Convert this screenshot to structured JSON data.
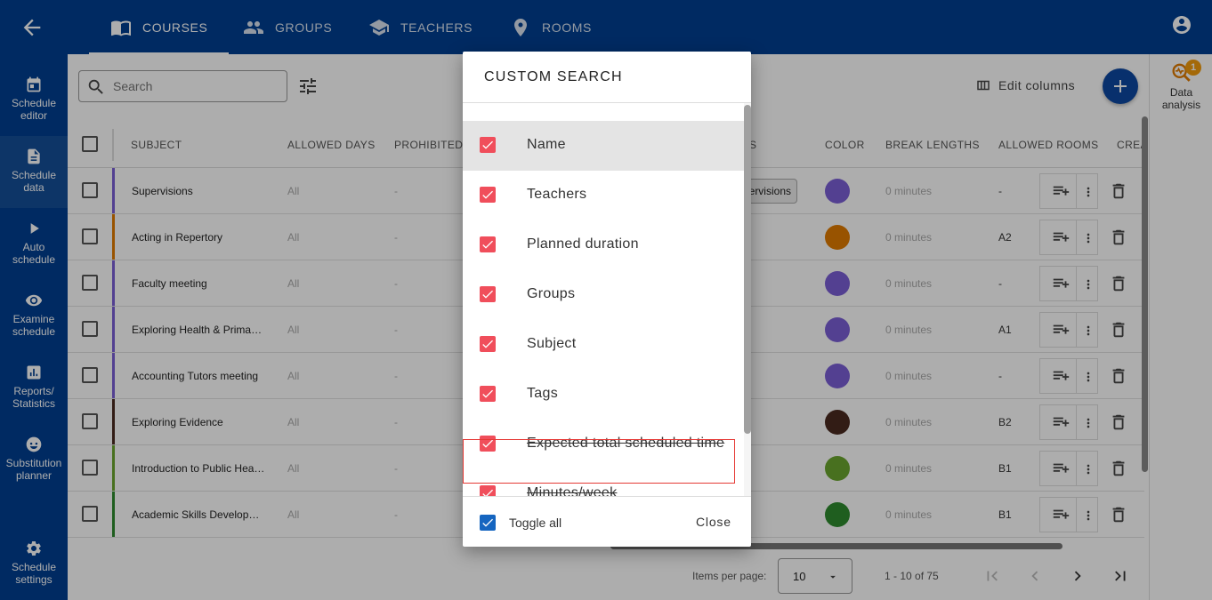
{
  "topnav": {
    "tabs": [
      {
        "label": "COURSES",
        "icon": "book-icon",
        "active": true
      },
      {
        "label": "GROUPS",
        "icon": "people-icon"
      },
      {
        "label": "TEACHERS",
        "icon": "school-icon"
      },
      {
        "label": "ROOMS",
        "icon": "location-pin-icon"
      }
    ]
  },
  "sidebar": {
    "items": [
      {
        "label1": "Schedule",
        "label2": "editor",
        "icon": "calendar-icon"
      },
      {
        "label1": "Schedule",
        "label2": "data",
        "icon": "document-icon"
      },
      {
        "label1": "Auto",
        "label2": "schedule",
        "icon": "play-icon"
      },
      {
        "label1": "Examine",
        "label2": "schedule",
        "icon": "eye-icon"
      },
      {
        "label1": "Reports/",
        "label2": "Statistics",
        "icon": "chart-icon"
      },
      {
        "label1": "Substitution",
        "label2": "planner",
        "icon": "face-icon"
      },
      {
        "label1": "Schedule",
        "label2": "settings",
        "icon": "gear-icon"
      }
    ]
  },
  "rightpanel": {
    "line1": "Data",
    "line2": "analysis",
    "badge": "1"
  },
  "toolbar": {
    "search_placeholder": "Search",
    "edit_columns": "Edit columns"
  },
  "table": {
    "headers": [
      "SUBJECT",
      "ALLOWED DAYS",
      "PROHIBITED T",
      "S",
      "COLOR",
      "BREAK LENGTHS",
      "ALLOWED ROOMS",
      "CREA"
    ],
    "rows": [
      {
        "subject": "Supervisions",
        "days": "All",
        "prohibited": "-",
        "tag": "ervisions",
        "color": "#7b5fd6",
        "bar": "#7b5fd6",
        "break": "0 minutes",
        "room": "-"
      },
      {
        "subject": "Acting in Repertory",
        "days": "All",
        "prohibited": "-",
        "color": "#e07b00",
        "bar": "#e07b00",
        "break": "0 minutes",
        "room": "A2"
      },
      {
        "subject": "Faculty meeting",
        "days": "All",
        "prohibited": "-",
        "color": "#7b5fd6",
        "bar": "#7b5fd6",
        "break": "0 minutes",
        "room": "-"
      },
      {
        "subject": "Exploring Health & Primary Care",
        "days": "All",
        "prohibited": "-",
        "color": "#7b5fd6",
        "bar": "#7b5fd6",
        "break": "0 minutes",
        "room": "A1"
      },
      {
        "subject": "Accounting Tutors meeting",
        "days": "All",
        "prohibited": "-",
        "color": "#7b5fd6",
        "bar": "#7b5fd6",
        "break": "0 minutes",
        "room": "-"
      },
      {
        "subject": "Exploring Evidence",
        "days": "All",
        "prohibited": "-",
        "color": "#4a2a1f",
        "bar": "#4a2a1f",
        "break": "0 minutes",
        "room": "B2"
      },
      {
        "subject": "Introduction to Public Health",
        "days": "All",
        "prohibited": "-",
        "color": "#6aa52e",
        "bar": "#6aa52e",
        "break": "0 minutes",
        "room": "B1"
      },
      {
        "subject": "Academic Skills Development",
        "days": "All",
        "prohibited": "-",
        "color": "#2e8b2e",
        "bar": "#2e8b2e",
        "break": "0 minutes",
        "room": "B1"
      }
    ]
  },
  "pager": {
    "items_per_page_label": "Items per page:",
    "items_per_page": "10",
    "range": "1 - 10 of 75"
  },
  "dialog": {
    "title": "CUSTOM SEARCH",
    "items": [
      {
        "label": "Name",
        "checked": true,
        "highlight": true
      },
      {
        "label": "Teachers",
        "checked": true
      },
      {
        "label": "Planned duration",
        "checked": true
      },
      {
        "label": "Groups",
        "checked": true
      },
      {
        "label": "Subject",
        "checked": true
      },
      {
        "label": "Tags",
        "checked": true
      },
      {
        "label": "Expected total scheduled time",
        "checked": true,
        "strike": true
      },
      {
        "label": "Minutes/week",
        "checked": true,
        "strike": true
      }
    ],
    "toggle_all": "Toggle all",
    "close": "Close"
  },
  "colors": {
    "brand": "#003f91",
    "checkbox_red": "#f04e5b",
    "checkbox_blue": "#1565c0"
  }
}
